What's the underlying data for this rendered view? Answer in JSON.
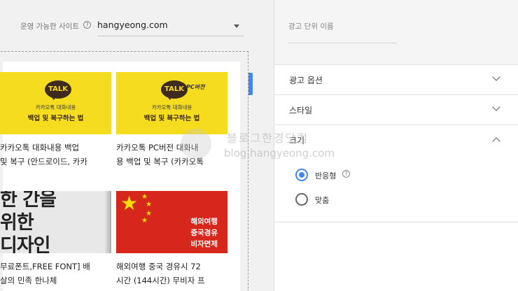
{
  "site_selector": {
    "label": "운영 가능한 사이트",
    "help": "?",
    "value": "hangyeong.com"
  },
  "preview": {
    "cards": [
      {
        "thumb_type": "kakao",
        "bubble": "TALK",
        "badge": "",
        "line1": "카카오톡 대화내용",
        "line2": "백업 및 복구하는 법",
        "title_line1": "카카오톡 대화내용 백업",
        "title_line2": "및 복구 (안드로이드, 카카"
      },
      {
        "thumb_type": "kakao",
        "bubble": "TALK",
        "badge": "PC버전",
        "line1": "카카오톡 대화내용",
        "line2": "백업 및 복구하는 법",
        "title_line1": "카카오톡 PC버전 대화내",
        "title_line2": "용 백업 및 복구 (카카오톡"
      },
      {
        "thumb_type": "typography",
        "big_line1": "한 간을",
        "big_line2": "위한",
        "big_line3": "디자인",
        "title_line1": "무료폰트,FREE FONT] 배",
        "title_line2": "살의 민족 한나체"
      },
      {
        "thumb_type": "china-flag",
        "red_line1": "해외여행",
        "red_line2": "중국경유",
        "red_line3": "비자면제",
        "title_line1": "해외여행 중국 경유시 72",
        "title_line2": "시간 (144시간) 무비자 프"
      }
    ]
  },
  "watermark": {
    "title": "블로그한경닷컴",
    "url": "blog.hangyeong.com"
  },
  "settings": {
    "unit_name_label": "광고 단위 이름",
    "sections": [
      {
        "label": "광고 옵션",
        "expanded": false
      },
      {
        "label": "스타일",
        "expanded": false
      },
      {
        "label": "크기",
        "expanded": true
      }
    ],
    "size_options": [
      {
        "label": "반응형",
        "help": "?",
        "checked": true
      },
      {
        "label": "맞춤",
        "help": "",
        "checked": false
      }
    ]
  },
  "colors": {
    "accent": "#4285f4",
    "kakao_yellow": "#f5dc1f",
    "kakao_brown": "#3d2b1f",
    "flag_red": "#d7271c",
    "flag_star": "#ffde00"
  }
}
